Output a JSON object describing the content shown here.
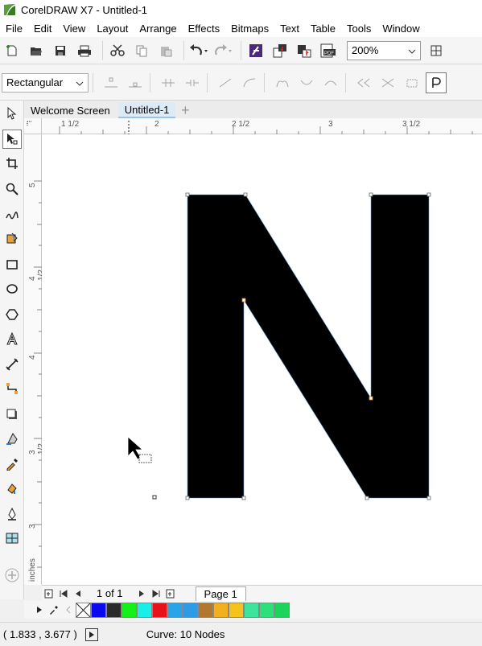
{
  "window": {
    "title": "CorelDRAW X7 - Untitled-1"
  },
  "menu": [
    "File",
    "Edit",
    "View",
    "Layout",
    "Arrange",
    "Effects",
    "Bitmaps",
    "Text",
    "Table",
    "Tools",
    "Window"
  ],
  "toolbar": {
    "icons": [
      "new-document-icon",
      "open-icon",
      "save-icon",
      "print-icon",
      "cut-icon",
      "copy-icon",
      "paste-icon",
      "undo-icon",
      "redo-icon",
      "corel-connect-icon",
      "import-icon",
      "export-icon",
      "publish-pdf-icon"
    ],
    "zoom": "200%"
  },
  "property_bar": {
    "selection_mode": "Rectangular"
  },
  "tabs": [
    {
      "label": "Welcome Screen",
      "active": false
    },
    {
      "label": "Untitled-1",
      "active": true
    }
  ],
  "ruler": {
    "horizontal": [
      "1 1/2",
      "2",
      "2 1/2",
      "3",
      "3 1/2"
    ],
    "vertical": [
      "5",
      "4 1/2",
      "4",
      "3 1/2",
      "3"
    ],
    "units": "inches"
  },
  "pages": {
    "count": "1 of 1",
    "tab": "Page 1"
  },
  "palette": [
    "#0a0af0",
    "#2b2b2b",
    "#15f01a",
    "#19efe8",
    "#e8121a",
    "#2aa4e8",
    "#2f9ae6",
    "#b1782f",
    "#f2b01e",
    "#f6c21c",
    "#3ee39c",
    "#2ee07a",
    "#1cd45b"
  ],
  "status": {
    "coords": "( 1.833 , 3.677 )",
    "object_info": "Curve: 10 Nodes"
  },
  "colors": {
    "accent": "#9cc3e5",
    "logo_green": "#5a9f3c"
  }
}
